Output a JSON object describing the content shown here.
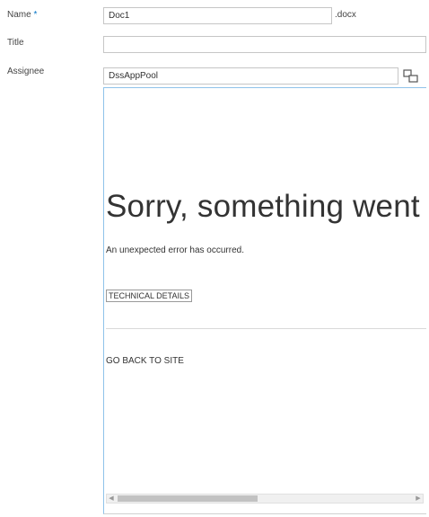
{
  "form": {
    "name_label": "Name",
    "required_mark": " *",
    "name_value": "Doc1",
    "name_ext": ".docx",
    "title_label": "Title",
    "title_value": "",
    "assignee_label": "Assignee",
    "assignee_value": "DssAppPool"
  },
  "error_frame": {
    "title": "Sorry, something went wro",
    "message": "An unexpected error has occurred.",
    "technical_details": "TECHNICAL DETAILS",
    "go_back": "GO BACK TO SITE"
  },
  "icons": {
    "picker": "people-picker-icon",
    "scroll_left": "scroll-left-arrow-icon",
    "scroll_right": "scroll-right-arrow-icon"
  },
  "colors": {
    "frame_border": "#8fc3ea",
    "required": "#0072c6",
    "field_border": "#c6c6c6"
  },
  "scroll": {
    "horizontal_position": 0.0
  }
}
